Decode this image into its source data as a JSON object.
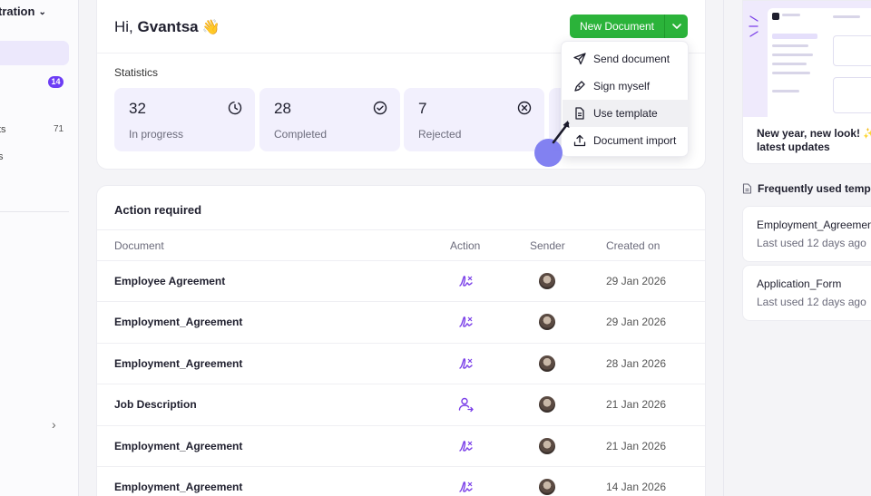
{
  "sidebar": {
    "workspace_title": "tration",
    "badge_count": "14",
    "item_1_label": "ts",
    "item_1_count": "71",
    "item_2_label": "s"
  },
  "header": {
    "greeting_prefix": "Hi,",
    "user_name": "Gvantsa",
    "wave_emoji": "👋",
    "new_document_label": "New Document"
  },
  "statistics": {
    "label": "Statistics",
    "items": [
      {
        "value": "32",
        "label": "In progress",
        "icon": "clock-icon"
      },
      {
        "value": "28",
        "label": "Completed",
        "icon": "check-circle-icon"
      },
      {
        "value": "7",
        "label": "Rejected",
        "icon": "x-circle-icon"
      }
    ]
  },
  "menu": {
    "items": [
      {
        "label": "Send document",
        "icon": "send-icon"
      },
      {
        "label": "Sign myself",
        "icon": "pen-icon"
      },
      {
        "label": "Use template",
        "icon": "template-icon"
      },
      {
        "label": "Document import",
        "icon": "upload-icon"
      }
    ],
    "hovered_index": 2
  },
  "action_required": {
    "title": "Action required",
    "columns": [
      "Document",
      "Action",
      "Sender",
      "Created on"
    ],
    "rows": [
      {
        "document": "Employee Agreement",
        "action": "sign-icon",
        "date": "29 Jan 2026"
      },
      {
        "document": "Employment_Agreement",
        "action": "sign-icon",
        "date": "29 Jan 2026"
      },
      {
        "document": "Employment_Agreement",
        "action": "sign-icon",
        "date": "28 Jan 2026"
      },
      {
        "document": "Job Description",
        "action": "assign-user-icon",
        "date": "21 Jan 2026"
      },
      {
        "document": "Employment_Agreement",
        "action": "sign-icon",
        "date": "21 Jan 2026"
      },
      {
        "document": "Employment_Agreement",
        "action": "sign-icon",
        "date": "14 Jan 2026"
      }
    ]
  },
  "right_panel": {
    "promo_text_line1": "New year, new look! ✨",
    "promo_text_line2": "latest updates",
    "frequently_used_title": "Frequently used templa",
    "templates": [
      {
        "name": "Employment_Agreement",
        "last_used": "Last used 12 days ago"
      },
      {
        "name": "Application_Form",
        "last_used": "Last used 12 days ago"
      }
    ]
  },
  "colors": {
    "accent": "#6d3df5",
    "primary_button": "#2bb33a",
    "stat_bg": "#f2f0fd"
  }
}
